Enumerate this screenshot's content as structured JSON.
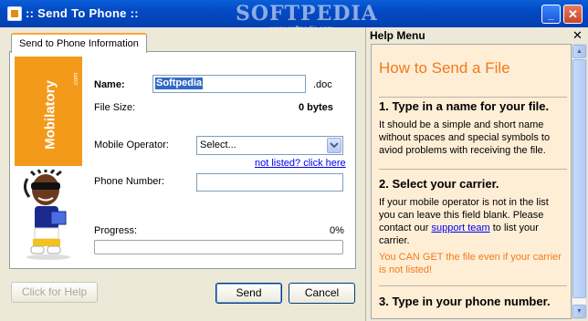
{
  "window": {
    "title": ":: Send To Phone ::",
    "watermark": "SOFTPEDIA",
    "watermark_url": "www.softpedia.com",
    "minimize_glyph": "_",
    "close_glyph": "✕"
  },
  "tab": {
    "label": "Send to Phone Information"
  },
  "banner": {
    "logo": "Mobilatory",
    "logo_suffix": ".com"
  },
  "form": {
    "name_label": "Name:",
    "name_value": "Softpedia",
    "ext": ".doc",
    "size_label": "File Size:",
    "size_value": "0 bytes",
    "operator_label": "Mobile Operator:",
    "operator_selected": "Select...",
    "not_listed_link": "not listed? click here",
    "phone_label": "Phone Number:",
    "phone_value": "",
    "progress_label": "Progress:",
    "progress_value": "0%",
    "progress_fraction": 0
  },
  "buttons": {
    "help": "Click for Help",
    "send": "Send",
    "cancel": "Cancel"
  },
  "help": {
    "header": "Help Menu",
    "close_glyph": "✕",
    "title": "How to Send a File",
    "steps": [
      {
        "heading": "1. Type in a name for your file.",
        "text": "It should be a simple and short name without spaces and special symbols to aviod problems with receiving the file."
      },
      {
        "heading": "2. Select your carrier.",
        "text_before": "If your mobile operator is not in the list you can leave this field blank. Please contact our ",
        "link": "support team",
        "text_after": " to list your carrier.",
        "note": "You CAN GET the file even if your carrier is not listed!"
      },
      {
        "heading": "3. Type in your phone number."
      }
    ]
  },
  "colors": {
    "accent_orange": "#f39a1a",
    "help_bg": "#ffeed6",
    "titlebar": "#0449c4"
  }
}
